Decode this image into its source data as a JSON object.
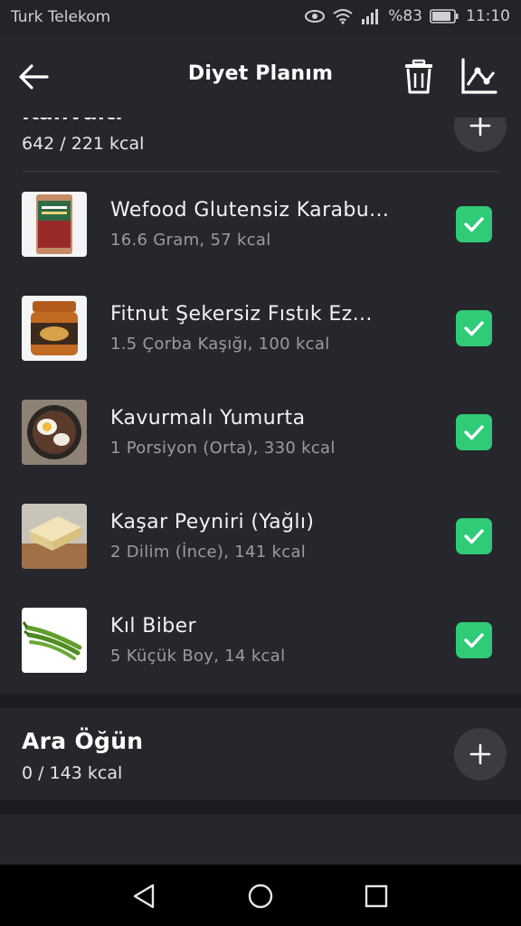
{
  "status_bar": {
    "carrier": "Turk Telekom",
    "battery": "%83",
    "time": "11:10",
    "icons": [
      "eye-icon",
      "wifi-icon",
      "signal-icon",
      "battery-icon"
    ]
  },
  "app_bar": {
    "title": "Diyet Planım",
    "icons": [
      "back-arrow-icon",
      "trash-icon",
      "chart-icon"
    ]
  },
  "meals": [
    {
      "title": "Kahvaltı",
      "kcal": "642 / 221 kcal",
      "items": [
        {
          "name": "Wefood Glutensiz Karabu...",
          "detail": "16.6 Gram, 57 kcal",
          "checked": true
        },
        {
          "name": "Fitnut Şekersiz Fıstık Ez...",
          "detail": "1.5 Çorba Kaşığı, 100 kcal",
          "checked": true
        },
        {
          "name": "Kavurmalı Yumurta",
          "detail": "1 Porsiyon (Orta), 330 kcal",
          "checked": true
        },
        {
          "name": "Kaşar Peyniri (Yağlı)",
          "detail": "2 Dilim (İnce), 141 kcal",
          "checked": true
        },
        {
          "name": "Kıl Biber",
          "detail": "5 Küçük Boy, 14 kcal",
          "checked": true
        }
      ]
    },
    {
      "title": "Ara Öğün",
      "kcal": "0 / 143 kcal",
      "items": []
    }
  ],
  "colors": {
    "background": "#1b1c21",
    "card": "#25272d",
    "check_green": "#2fcb77",
    "add_button": "#3a3c42",
    "secondary_text": "#9a9ca2"
  }
}
